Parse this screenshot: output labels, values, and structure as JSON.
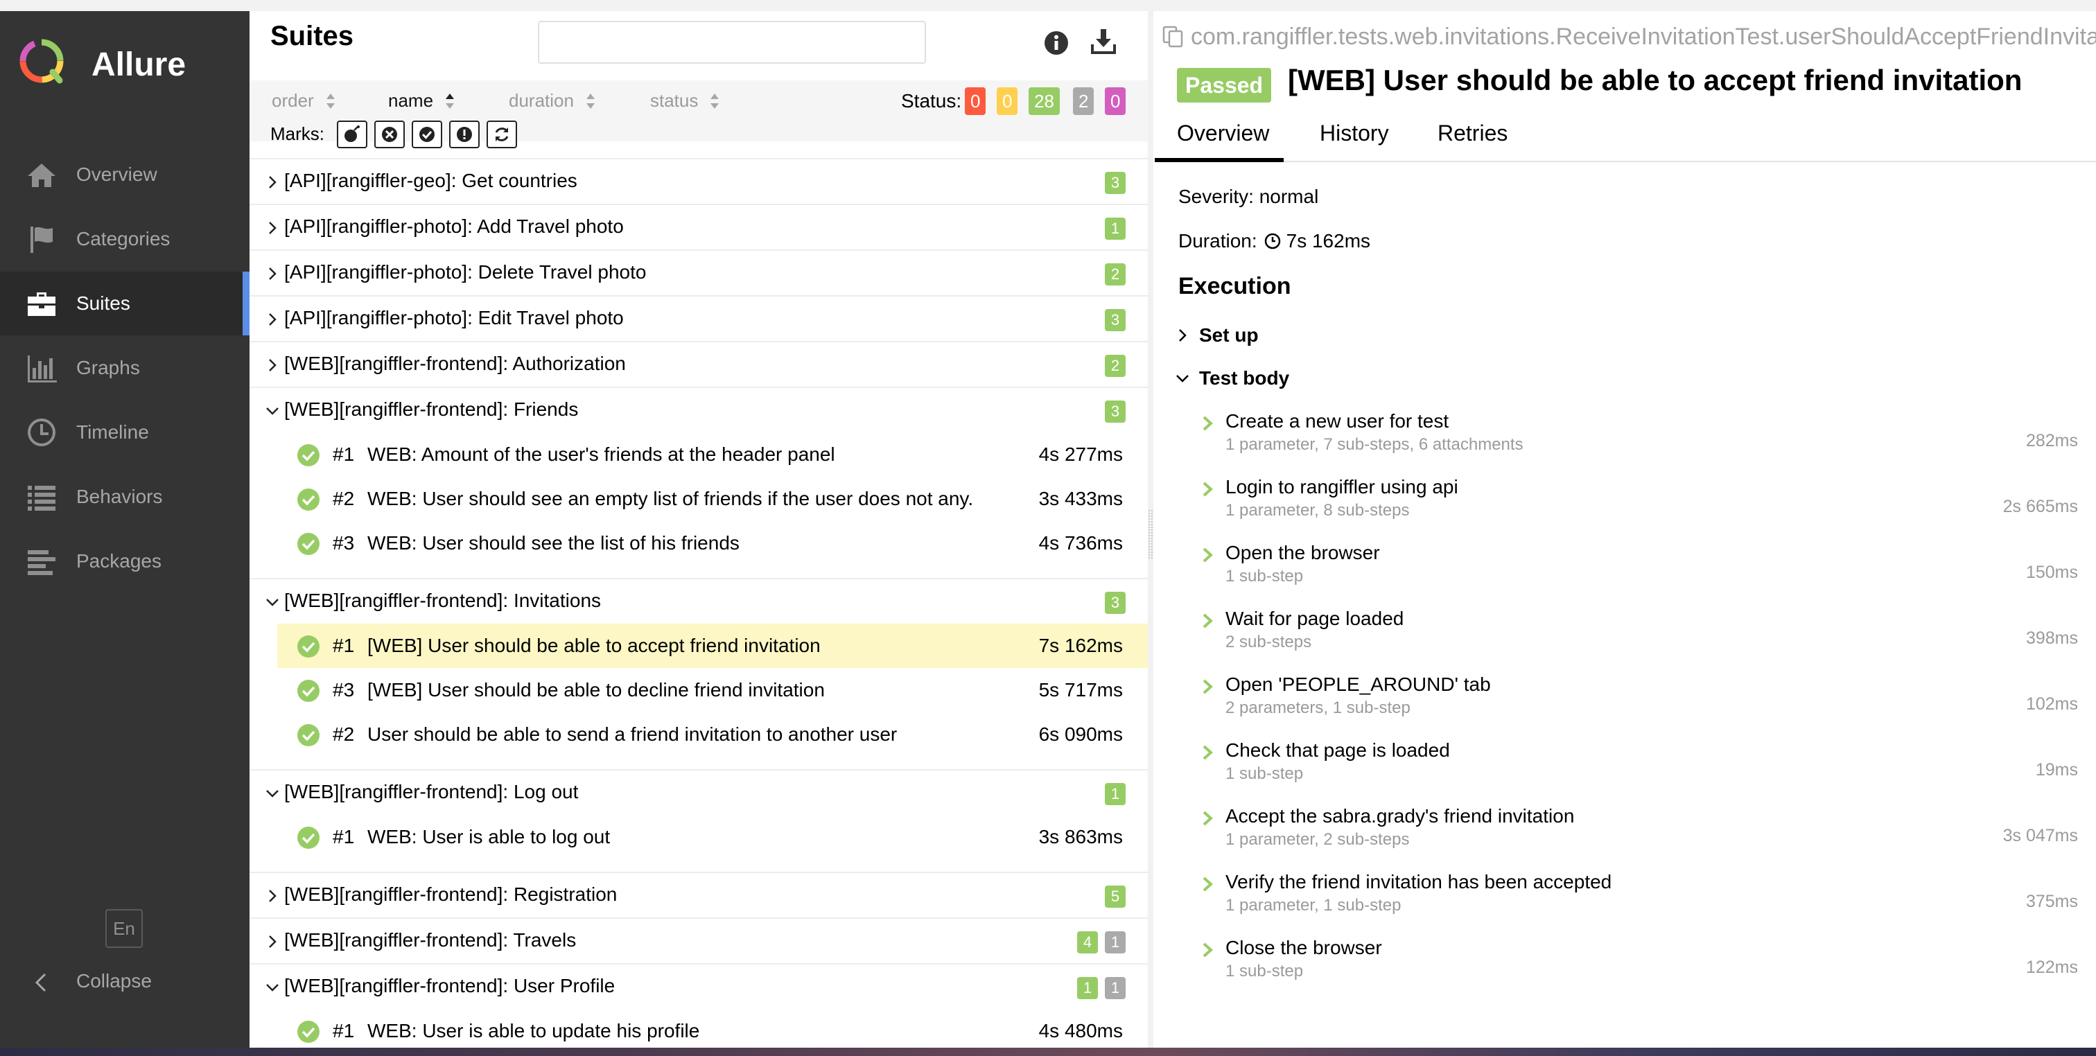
{
  "app": {
    "brand": "Allure"
  },
  "sidebar": {
    "items": [
      {
        "label": "Overview",
        "icon": "home-icon"
      },
      {
        "label": "Categories",
        "icon": "flag-icon"
      },
      {
        "label": "Suites",
        "icon": "briefcase-icon",
        "active": true
      },
      {
        "label": "Graphs",
        "icon": "bar-chart-icon"
      },
      {
        "label": "Timeline",
        "icon": "clock-icon"
      },
      {
        "label": "Behaviors",
        "icon": "list-icon"
      },
      {
        "label": "Packages",
        "icon": "align-left-icon"
      }
    ],
    "language": "En",
    "collapse_label": "Collapse"
  },
  "suites": {
    "title": "Suites",
    "search_placeholder": "",
    "sort": {
      "order": "order",
      "name": "name",
      "duration": "duration",
      "status": "status"
    },
    "status_label": "Status:",
    "status_counts": {
      "failed": "0",
      "broken": "0",
      "passed": "28",
      "skipped": "2",
      "unknown": "0"
    },
    "marks_label": "Marks:",
    "groups": [
      {
        "name": "[API][rangiffler-geo]: Get countries",
        "expanded": false,
        "passed": "3"
      },
      {
        "name": "[API][rangiffler-photo]: Add Travel photo",
        "expanded": false,
        "passed": "1"
      },
      {
        "name": "[API][rangiffler-photo]: Delete Travel photo",
        "expanded": false,
        "passed": "2"
      },
      {
        "name": "[API][rangiffler-photo]: Edit Travel photo",
        "expanded": false,
        "passed": "3"
      },
      {
        "name": "[WEB][rangiffler-frontend]: Authorization",
        "expanded": false,
        "passed": "2"
      },
      {
        "name": "[WEB][rangiffler-frontend]: Friends",
        "expanded": true,
        "passed": "3",
        "tests": [
          {
            "num": "#1",
            "name": "WEB: Amount of the user's friends at the header panel",
            "duration": "4s 277ms"
          },
          {
            "num": "#2",
            "name": "WEB: User should see an empty list of friends if the user does not any.",
            "duration": "3s 433ms"
          },
          {
            "num": "#3",
            "name": "WEB: User should see the list of his friends",
            "duration": "4s 736ms"
          }
        ]
      },
      {
        "name": "[WEB][rangiffler-frontend]: Invitations",
        "expanded": true,
        "passed": "3",
        "tests": [
          {
            "num": "#1",
            "name": "[WEB] User should be able to accept friend invitation",
            "duration": "7s 162ms",
            "selected": true
          },
          {
            "num": "#3",
            "name": "[WEB] User should be able to decline friend invitation",
            "duration": "5s 717ms"
          },
          {
            "num": "#2",
            "name": "User should be able to send a friend invitation to another user",
            "duration": "6s 090ms"
          }
        ]
      },
      {
        "name": "[WEB][rangiffler-frontend]: Log out",
        "expanded": true,
        "passed": "1",
        "tests": [
          {
            "num": "#1",
            "name": "WEB: User is able to log out",
            "duration": "3s 863ms"
          }
        ]
      },
      {
        "name": "[WEB][rangiffler-frontend]: Registration",
        "expanded": false,
        "passed": "5"
      },
      {
        "name": "[WEB][rangiffler-frontend]: Travels",
        "expanded": false,
        "passed": "4",
        "skipped": "1"
      },
      {
        "name": "[WEB][rangiffler-frontend]: User Profile",
        "expanded": true,
        "passed": "1",
        "skipped": "1",
        "tests": [
          {
            "num": "#1",
            "name": "WEB: User is able to update his profile",
            "duration": "4s 480ms"
          }
        ]
      }
    ]
  },
  "detail": {
    "full_name": "com.rangiffler.tests.web.invitations.ReceiveInvitationTest.userShouldAcceptFriendInvitation",
    "status": "Passed",
    "title": "[WEB] User should be able to accept friend invitation",
    "tabs": [
      "Overview",
      "History",
      "Retries"
    ],
    "severity": "Severity: normal",
    "duration_label": "Duration:",
    "duration": "7s 162ms",
    "execution_title": "Execution",
    "setup_label": "Set up",
    "test_body_label": "Test body",
    "steps": [
      {
        "name": "Create a new user for test",
        "sub": "1 parameter, 7 sub-steps, 6 attachments",
        "duration": "282ms"
      },
      {
        "name": "Login to rangiffler using api",
        "sub": "1 parameter, 8 sub-steps",
        "duration": "2s 665ms"
      },
      {
        "name": "Open the browser",
        "sub": "1 sub-step",
        "duration": "150ms"
      },
      {
        "name": "Wait for page loaded",
        "sub": "2 sub-steps",
        "duration": "398ms"
      },
      {
        "name": "Open 'PEOPLE_AROUND' tab",
        "sub": "2 parameters, 1 sub-step",
        "duration": "102ms"
      },
      {
        "name": "Check that page is loaded",
        "sub": "1 sub-step",
        "duration": "19ms"
      },
      {
        "name": "Accept the sabra.grady's friend invitation",
        "sub": "1 parameter, 2 sub-steps",
        "duration": "3s 047ms"
      },
      {
        "name": "Verify the friend invitation has been accepted",
        "sub": "1 parameter, 1 sub-step",
        "duration": "375ms"
      },
      {
        "name": "Close the browser",
        "sub": "1 sub-step",
        "duration": "122ms"
      }
    ]
  },
  "colors": {
    "passed": "#97cc64",
    "failed": "#fd5a3e",
    "broken": "#ffd050",
    "skipped": "#aaaaaa",
    "unknown": "#d35ebe",
    "sidebar_bg": "#343434",
    "accent": "#5b8ee6",
    "selected_row": "#fdf7c5"
  }
}
